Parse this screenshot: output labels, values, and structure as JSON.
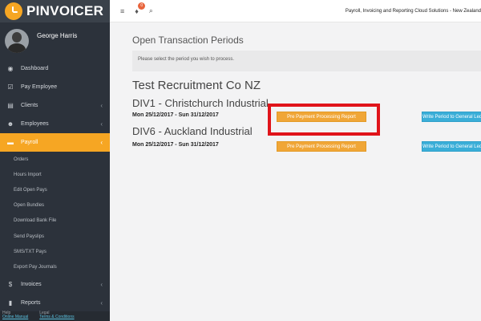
{
  "brand": {
    "name": "PINVOICER"
  },
  "user": {
    "name": "George Harris"
  },
  "sidebar": {
    "items": [
      {
        "label": "Dashboard",
        "icon": "tachometer-icon",
        "glyph": "◉",
        "chevron": false
      },
      {
        "label": "Pay Employee",
        "icon": "check-square-icon",
        "glyph": "☑",
        "chevron": false
      },
      {
        "label": "Clients",
        "icon": "building-icon",
        "glyph": "▤",
        "chevron": true
      },
      {
        "label": "Employees",
        "icon": "users-icon",
        "glyph": "☻",
        "chevron": true
      },
      {
        "label": "Payroll",
        "icon": "folder-icon",
        "glyph": "▬",
        "chevron": true,
        "active": true
      }
    ],
    "submenu": [
      "Orders",
      "Hours Import",
      "Edit Open Pays",
      "Open Bundles",
      "Download Bank File",
      "Send Payslips",
      "SMS/TXT Pays",
      "Export Pay Journals"
    ],
    "bottom_items": [
      {
        "label": "Invoices",
        "icon": "dollar-icon",
        "glyph": "$",
        "chevron": true
      },
      {
        "label": "Reports",
        "icon": "bar-chart-icon",
        "glyph": "▮",
        "chevron": true
      }
    ],
    "footer": {
      "help_label": "Help",
      "help_link": "Online Manual",
      "legal_label": "Legal",
      "legal_link": "Terms & Conditions"
    }
  },
  "topbar": {
    "menu_icon": "≡",
    "bell_icon": "♦",
    "notification_count": "0",
    "search_icon": "⌕",
    "app_title": "Payroll, Invoicing and Reporting Cloud Solutions - New Zealand"
  },
  "main": {
    "page_title": "Open Transaction Periods",
    "notice": "Please select the period you wish to process.",
    "company": "Test Recruitment Co NZ",
    "divisions": [
      {
        "name": "DIV1 - Christchurch Industrial",
        "period": "Mon 25/12/2017 - Sun 31/12/2017",
        "report_button": "Pre Payment Processing Report",
        "write_button": "Write Period to General Ledger"
      },
      {
        "name": "DIV6 - Auckland Industrial",
        "period": "Mon 25/12/2017 - Sun 31/12/2017",
        "report_button": "Pre Payment Processing Report",
        "write_button": "Write Period to General Ledger"
      }
    ]
  },
  "colors": {
    "accent": "#f6a623",
    "sidebar_bg": "#2c323b",
    "button_orange": "#f0a637",
    "button_blue": "#3aaed8",
    "highlight": "#e0141a"
  }
}
